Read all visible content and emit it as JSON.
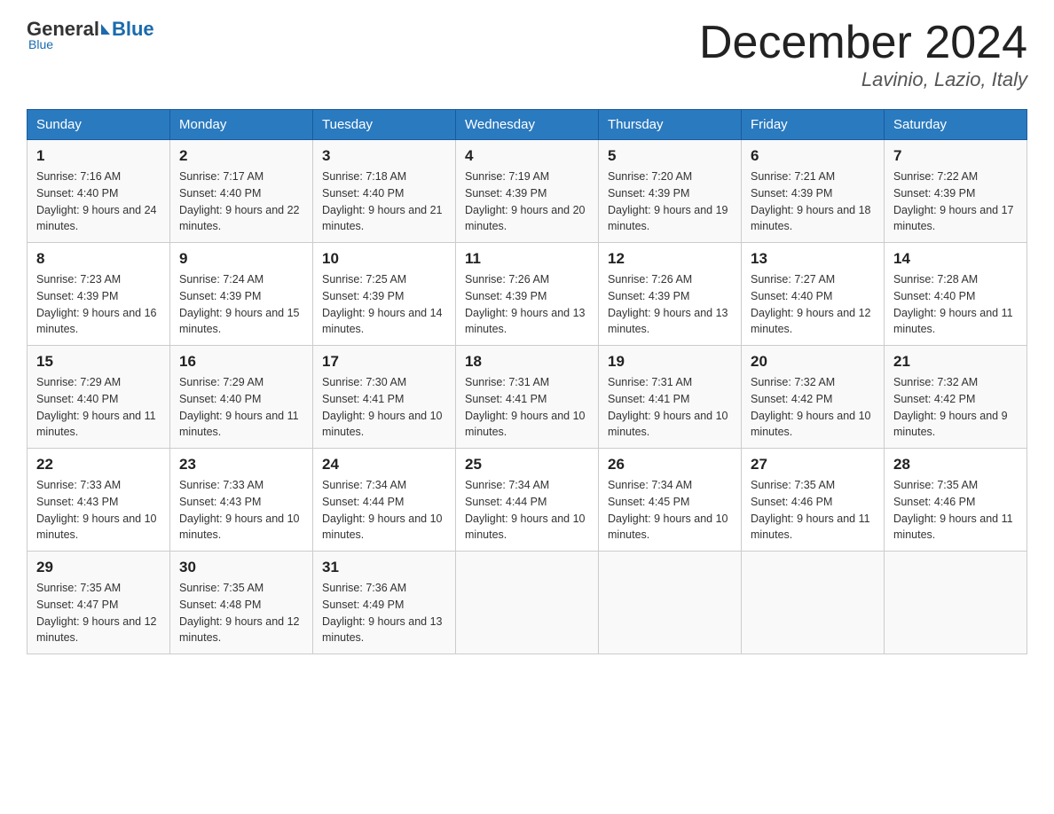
{
  "header": {
    "logo_general": "General",
    "logo_blue": "Blue",
    "month_title": "December 2024",
    "location": "Lavinio, Lazio, Italy"
  },
  "days_of_week": [
    "Sunday",
    "Monday",
    "Tuesday",
    "Wednesday",
    "Thursday",
    "Friday",
    "Saturday"
  ],
  "weeks": [
    [
      {
        "day": "1",
        "sunrise": "7:16 AM",
        "sunset": "4:40 PM",
        "daylight": "9 hours and 24 minutes."
      },
      {
        "day": "2",
        "sunrise": "7:17 AM",
        "sunset": "4:40 PM",
        "daylight": "9 hours and 22 minutes."
      },
      {
        "day": "3",
        "sunrise": "7:18 AM",
        "sunset": "4:40 PM",
        "daylight": "9 hours and 21 minutes."
      },
      {
        "day": "4",
        "sunrise": "7:19 AM",
        "sunset": "4:39 PM",
        "daylight": "9 hours and 20 minutes."
      },
      {
        "day": "5",
        "sunrise": "7:20 AM",
        "sunset": "4:39 PM",
        "daylight": "9 hours and 19 minutes."
      },
      {
        "day": "6",
        "sunrise": "7:21 AM",
        "sunset": "4:39 PM",
        "daylight": "9 hours and 18 minutes."
      },
      {
        "day": "7",
        "sunrise": "7:22 AM",
        "sunset": "4:39 PM",
        "daylight": "9 hours and 17 minutes."
      }
    ],
    [
      {
        "day": "8",
        "sunrise": "7:23 AM",
        "sunset": "4:39 PM",
        "daylight": "9 hours and 16 minutes."
      },
      {
        "day": "9",
        "sunrise": "7:24 AM",
        "sunset": "4:39 PM",
        "daylight": "9 hours and 15 minutes."
      },
      {
        "day": "10",
        "sunrise": "7:25 AM",
        "sunset": "4:39 PM",
        "daylight": "9 hours and 14 minutes."
      },
      {
        "day": "11",
        "sunrise": "7:26 AM",
        "sunset": "4:39 PM",
        "daylight": "9 hours and 13 minutes."
      },
      {
        "day": "12",
        "sunrise": "7:26 AM",
        "sunset": "4:39 PM",
        "daylight": "9 hours and 13 minutes."
      },
      {
        "day": "13",
        "sunrise": "7:27 AM",
        "sunset": "4:40 PM",
        "daylight": "9 hours and 12 minutes."
      },
      {
        "day": "14",
        "sunrise": "7:28 AM",
        "sunset": "4:40 PM",
        "daylight": "9 hours and 11 minutes."
      }
    ],
    [
      {
        "day": "15",
        "sunrise": "7:29 AM",
        "sunset": "4:40 PM",
        "daylight": "9 hours and 11 minutes."
      },
      {
        "day": "16",
        "sunrise": "7:29 AM",
        "sunset": "4:40 PM",
        "daylight": "9 hours and 11 minutes."
      },
      {
        "day": "17",
        "sunrise": "7:30 AM",
        "sunset": "4:41 PM",
        "daylight": "9 hours and 10 minutes."
      },
      {
        "day": "18",
        "sunrise": "7:31 AM",
        "sunset": "4:41 PM",
        "daylight": "9 hours and 10 minutes."
      },
      {
        "day": "19",
        "sunrise": "7:31 AM",
        "sunset": "4:41 PM",
        "daylight": "9 hours and 10 minutes."
      },
      {
        "day": "20",
        "sunrise": "7:32 AM",
        "sunset": "4:42 PM",
        "daylight": "9 hours and 10 minutes."
      },
      {
        "day": "21",
        "sunrise": "7:32 AM",
        "sunset": "4:42 PM",
        "daylight": "9 hours and 9 minutes."
      }
    ],
    [
      {
        "day": "22",
        "sunrise": "7:33 AM",
        "sunset": "4:43 PM",
        "daylight": "9 hours and 10 minutes."
      },
      {
        "day": "23",
        "sunrise": "7:33 AM",
        "sunset": "4:43 PM",
        "daylight": "9 hours and 10 minutes."
      },
      {
        "day": "24",
        "sunrise": "7:34 AM",
        "sunset": "4:44 PM",
        "daylight": "9 hours and 10 minutes."
      },
      {
        "day": "25",
        "sunrise": "7:34 AM",
        "sunset": "4:44 PM",
        "daylight": "9 hours and 10 minutes."
      },
      {
        "day": "26",
        "sunrise": "7:34 AM",
        "sunset": "4:45 PM",
        "daylight": "9 hours and 10 minutes."
      },
      {
        "day": "27",
        "sunrise": "7:35 AM",
        "sunset": "4:46 PM",
        "daylight": "9 hours and 11 minutes."
      },
      {
        "day": "28",
        "sunrise": "7:35 AM",
        "sunset": "4:46 PM",
        "daylight": "9 hours and 11 minutes."
      }
    ],
    [
      {
        "day": "29",
        "sunrise": "7:35 AM",
        "sunset": "4:47 PM",
        "daylight": "9 hours and 12 minutes."
      },
      {
        "day": "30",
        "sunrise": "7:35 AM",
        "sunset": "4:48 PM",
        "daylight": "9 hours and 12 minutes."
      },
      {
        "day": "31",
        "sunrise": "7:36 AM",
        "sunset": "4:49 PM",
        "daylight": "9 hours and 13 minutes."
      },
      null,
      null,
      null,
      null
    ]
  ]
}
